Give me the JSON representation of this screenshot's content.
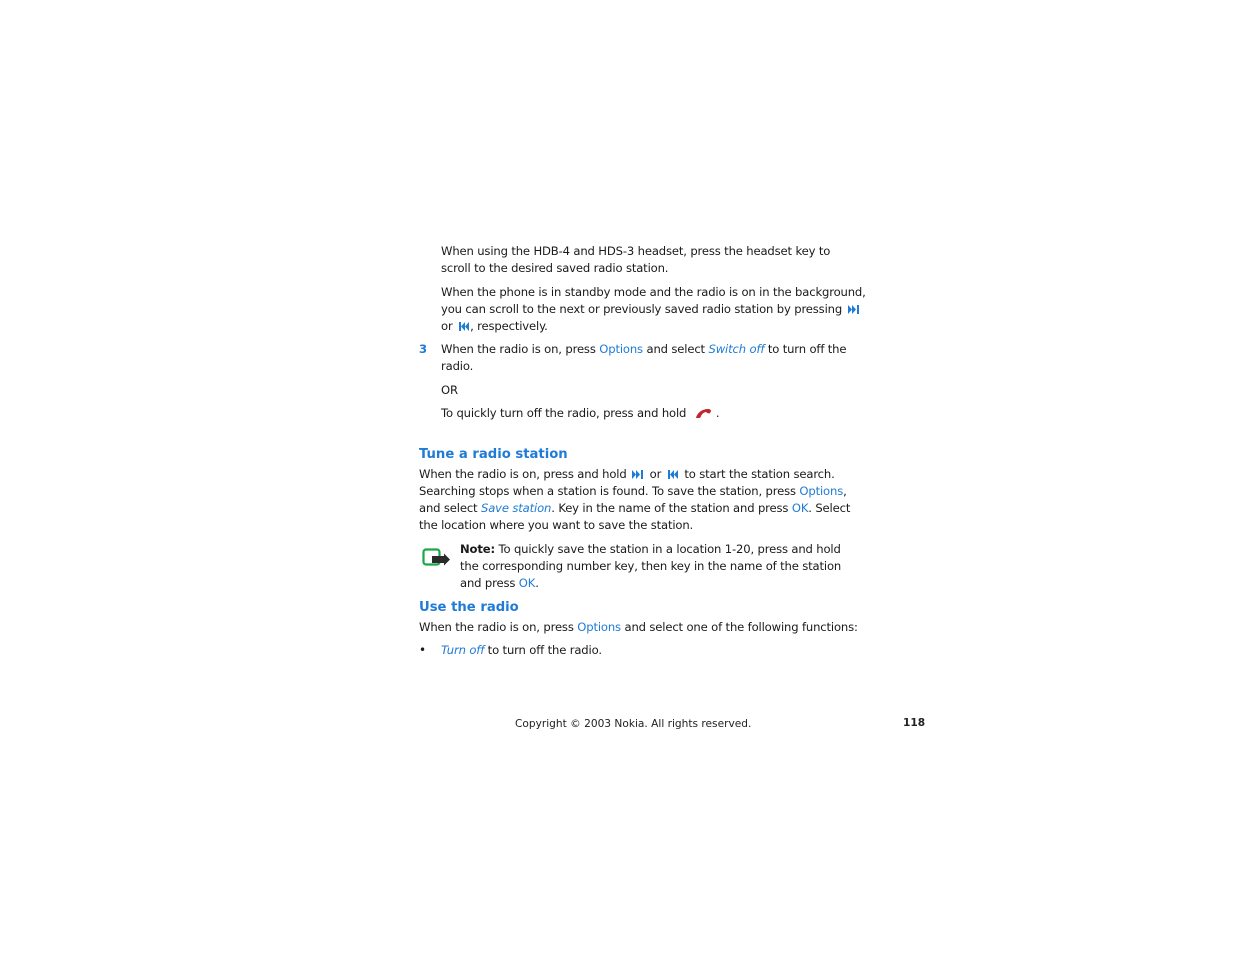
{
  "colors": {
    "accent_blue": "#1f7bd6",
    "end_key_red": "#c0272d",
    "note_green": "#1aa64a",
    "text": "#1a1a1a"
  },
  "icons": {
    "next": "next-track-icon",
    "prev": "previous-track-icon",
    "end": "end-call-key-icon",
    "note": "note-icon"
  },
  "para1": {
    "line1": "When using the HDB-4 and HDS-3 headset, press the headset key to",
    "line2": "scroll to the desired saved radio station."
  },
  "para2": {
    "line1": "When the phone is in standby mode and the radio is on in the background,",
    "line2a": "you can scroll to the next or previously saved radio station by pressing",
    "line3a": "or",
    "line3b": ", respectively."
  },
  "step3": {
    "number": "3",
    "line1a": "When the radio is on, press",
    "options": "Options",
    "line1b": "and select",
    "switch_off": "Switch off",
    "line1c": "to turn off the",
    "line2": "radio.",
    "or": "OR",
    "quick_a": "To quickly turn off the radio, press and hold",
    "quick_b": "."
  },
  "tune": {
    "heading": "Tune a radio station",
    "l1a": "When the radio is on, press and hold",
    "l1b": "or",
    "l1c": "to start the station search.",
    "l2a": "Searching stops when a station is found. To save the station, press",
    "l2_options": "Options",
    "l2b": ",",
    "l3a": "and select",
    "l3_save": "Save station",
    "l3b": ". Key in the name of the station and press",
    "l3_ok": "OK",
    "l3c": ". Select",
    "l4": "the location where you want to save the station."
  },
  "note": {
    "label": "Note:",
    "l1": "To quickly save the station in a location 1-20, press and hold",
    "l2": "the corresponding number key, then key in the name of the station",
    "l3a": "and press",
    "l3_ok": "OK",
    "l3b": "."
  },
  "use": {
    "heading": "Use the radio",
    "l1a": "When the radio is on, press",
    "l1_options": "Options",
    "l1b": "and select one of the following functions:",
    "bullet": "•",
    "item1_link": "Turn off",
    "item1_rest": "to turn off the radio."
  },
  "footer": {
    "copyright": "Copyright © 2003 Nokia. All rights reserved.",
    "page_number": "118"
  }
}
